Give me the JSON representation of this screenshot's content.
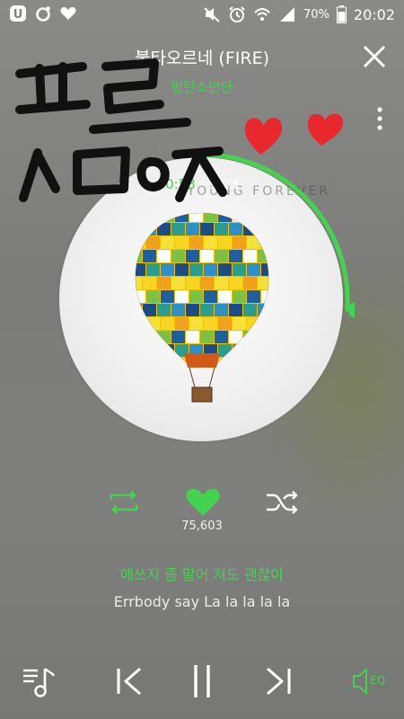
{
  "status_bar": {
    "battery": "70%",
    "time": "20:02",
    "icons": [
      "u-plus-icon",
      "dot-circle-icon",
      "heart-icon",
      "mute-icon",
      "alarm-icon",
      "wifi-icon",
      "signal-icon",
      "battery-icon"
    ]
  },
  "header": {
    "title": "불타오르네 (FIRE)",
    "artist": "방탄소년단",
    "close_icon": "close-icon",
    "more_icon": "more-vertical-icon"
  },
  "player": {
    "current_time": "0:53",
    "separator": "·",
    "total_time": "3:23",
    "progress": 0.26,
    "album_watermark": "YOUNG FOREVER",
    "like_count": "75,603",
    "liked": true
  },
  "lyrics": {
    "current": "애쓰지 좀 말어 져도 괜찮아",
    "next": "Errbody say La la la la la"
  },
  "bottom_bar": {
    "eq_label": "EQ"
  },
  "colors": {
    "accent": "#43d34e",
    "heart_doodle": "#e8282d",
    "text": "#ffffff"
  }
}
